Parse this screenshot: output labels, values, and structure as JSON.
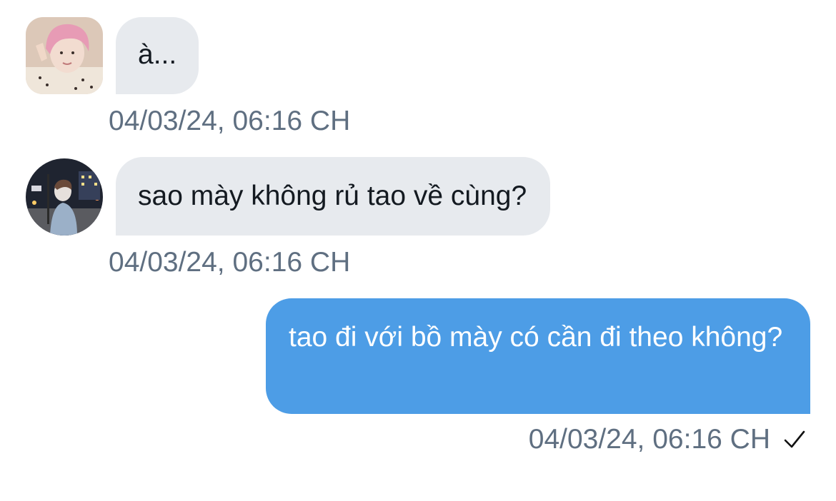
{
  "conversation": {
    "messages": [
      {
        "direction": "incoming",
        "text": "à...",
        "timestamp": "04/03/24, 06:16 CH",
        "avatar": "avatar-pink-hair"
      },
      {
        "direction": "incoming",
        "text": "sao mày không rủ tao về cùng?",
        "timestamp": "04/03/24, 06:16 CH",
        "avatar": "avatar-night-street"
      },
      {
        "direction": "outgoing",
        "text": "tao đi với bồ mày có cần đi theo không?",
        "timestamp": "04/03/24, 06:16 CH",
        "status_icon": "check-icon"
      }
    ]
  },
  "colors": {
    "incoming_bubble": "#e7eaee",
    "outgoing_bubble": "#4d9de6",
    "timestamp_text": "#5f6f81",
    "incoming_text": "#141a21"
  }
}
